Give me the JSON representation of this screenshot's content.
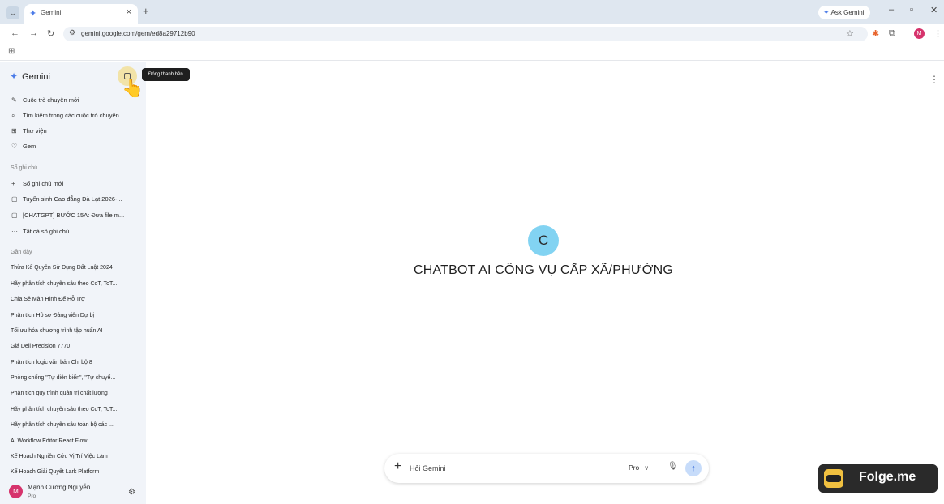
{
  "browser": {
    "tab_title": "Gemini",
    "ask_gemini": "Ask Gemini",
    "url": "gemini.google.com/gem/ed8a29712b90"
  },
  "sidebar": {
    "brand": "Gemini",
    "tooltip": "Đóng thanh bên",
    "items": [
      {
        "label": "Cuộc trò chuyện mới",
        "icon": "edit-icon"
      },
      {
        "label": "Tìm kiếm trong các cuộc trò chuyện",
        "icon": "search-icon"
      },
      {
        "label": "Thư viện",
        "icon": "library-icon"
      },
      {
        "label": "Gem",
        "icon": "gem-icon"
      }
    ],
    "notebooks_label": "Sổ ghi chú",
    "notebooks": [
      {
        "label": "Sổ ghi chú mới",
        "icon": "plus-icon"
      },
      {
        "label": "Tuyển sinh Cao đẳng Đà Lạt 2026-...",
        "icon": "notebook-icon"
      },
      {
        "label": "[CHATGPT] BƯỚC 15A: Đưa file m...",
        "icon": "notebook-icon"
      },
      {
        "label": "Tất cả sổ ghi chú",
        "icon": "more-icon"
      }
    ],
    "recent_label": "Gần đây",
    "recent": [
      "Thừa Kế Quyền Sử Dụng Đất Luật 2024",
      "Hãy phân tích chuyên sâu theo CoT, ToT...",
      "Chia Sẻ Màn Hình Để Hỗ Trợ",
      "Phân tích Hồ sơ Đảng viên Dự bị",
      "Tối ưu hóa chương trình tập huấn AI",
      "Giá Dell Precision 7770",
      "Phân tích logic văn bản Chi bộ 8",
      "Phòng chống \"Tự diễn biến\", \"Tự chuyể...",
      "Phân tích quy trình quản trị chất lượng",
      "Hãy phân tích chuyên sâu theo CoT, ToT...",
      "Hãy phân tích chuyên sâu toàn bộ các ...",
      "AI Workflow Editor React Flow",
      "Kế Hoạch Nghiên Cứu Vị Trí Việc Làm",
      "Kế Hoạch Giải Quyết Lark Platform"
    ],
    "user": {
      "initial": "M",
      "name": "Mạnh Cường Nguyễn",
      "plan": "Pro"
    }
  },
  "main": {
    "gem_initial": "C",
    "gem_title": "CHATBOT AI CÔNG VỤ CẤP XÃ/PHƯỜNG",
    "composer": {
      "placeholder": "Hỏi Gemini",
      "model": "Pro"
    }
  },
  "watermark": {
    "text": "Folge.me"
  },
  "colors": {
    "accent": "#4b7be8",
    "sidebar_bg": "#f1f4f9",
    "gem_avatar": "#82d3f2",
    "highlight": "#f2e3a8"
  }
}
